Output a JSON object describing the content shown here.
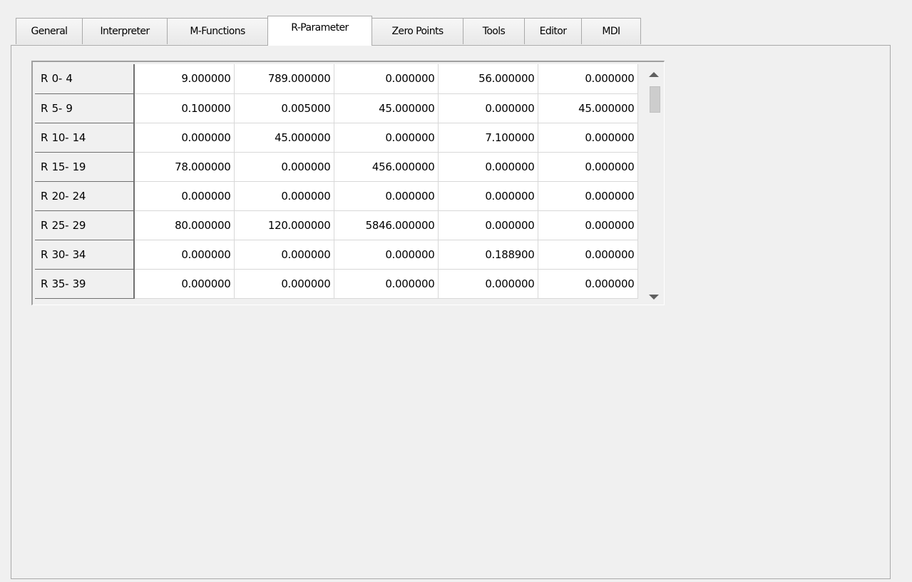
{
  "tabs": [
    {
      "id": "general",
      "label": "General"
    },
    {
      "id": "interpreter",
      "label": "Interpreter"
    },
    {
      "id": "m-functions",
      "label": "M-Functions"
    },
    {
      "id": "r-parameter",
      "label": "R-Parameter"
    },
    {
      "id": "zero-points",
      "label": "Zero Points"
    },
    {
      "id": "tools",
      "label": "Tools"
    },
    {
      "id": "editor",
      "label": "Editor"
    },
    {
      "id": "mdi",
      "label": "MDI"
    }
  ],
  "active_tab": "R-Parameter",
  "grid": {
    "rows": [
      {
        "label": "R  0- 4",
        "values": [
          "9.000000",
          "789.000000",
          "0.000000",
          "56.000000",
          "0.000000"
        ]
      },
      {
        "label": "R  5- 9",
        "values": [
          "0.100000",
          "0.005000",
          "45.000000",
          "0.000000",
          "45.000000"
        ]
      },
      {
        "label": "R 10- 14",
        "values": [
          "0.000000",
          "45.000000",
          "0.000000",
          "7.100000",
          "0.000000"
        ]
      },
      {
        "label": "R 15- 19",
        "values": [
          "78.000000",
          "0.000000",
          "456.000000",
          "0.000000",
          "0.000000"
        ]
      },
      {
        "label": "R 20- 24",
        "values": [
          "0.000000",
          "0.000000",
          "0.000000",
          "0.000000",
          "0.000000"
        ]
      },
      {
        "label": "R 25- 29",
        "values": [
          "80.000000",
          "120.000000",
          "5846.000000",
          "0.000000",
          "0.000000"
        ]
      },
      {
        "label": "R 30- 34",
        "values": [
          "0.000000",
          "0.000000",
          "0.000000",
          "0.188900",
          "0.000000"
        ]
      },
      {
        "label": "R 35- 39",
        "values": [
          "0.000000",
          "0.000000",
          "0.000000",
          "0.000000",
          "0.000000"
        ]
      }
    ]
  },
  "icons": {
    "scroll_up": "scroll-up-arrow-icon",
    "scroll_down": "scroll-down-arrow-icon"
  },
  "colors": {
    "window_bg": "#f0f0f0",
    "cell_bg": "#ffffff",
    "border": "#a9a9a9"
  }
}
